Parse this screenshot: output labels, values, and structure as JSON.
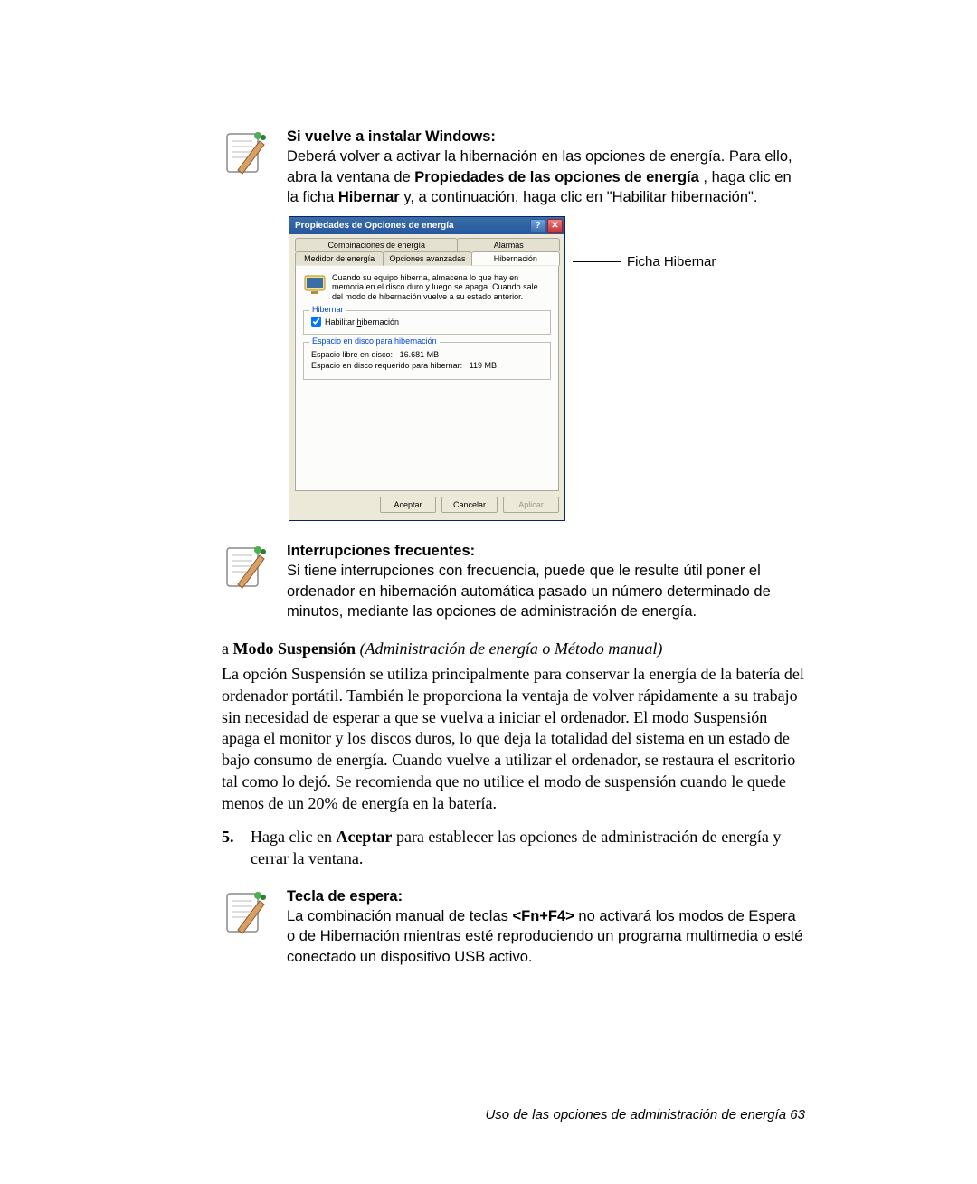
{
  "note1": {
    "heading": "Si vuelve a instalar Windows:",
    "l1a": "Deberá volver a activar la hibernación en las opciones de energía. Para ello, abra la ventana de ",
    "l1b": "Propiedades de las opciones de energía",
    "l1c": " , haga clic en la ficha ",
    "l1d": "Hibernar",
    "l1e": " y, a continuación, haga clic en \"Habilitar hibernación\"."
  },
  "dialog": {
    "title": "Propiedades de Opciones de energía",
    "tabs_row1": {
      "a": "Combinaciones de energía",
      "b": "Alarmas"
    },
    "tabs_row2": {
      "a": "Medidor de energía",
      "b": "Opciones avanzadas",
      "c": "Hibernación"
    },
    "info": "Cuando su equipo hiberna, almacena lo que hay en memoria en el disco duro y luego se apaga. Cuando sale del modo de hibernación vuelve a su estado anterior.",
    "fs1_legend": "Hibernar",
    "chk_label_pre": "Habilitar ",
    "chk_label_u": "h",
    "chk_label_post": "ibernación",
    "fs2_legend": "Espacio en disco para hibernación",
    "free_lbl": "Espacio libre en disco:",
    "free_val": "16.681 MB",
    "req_lbl": "Espacio en disco requerido para hibernar:",
    "req_val": "119 MB",
    "btn_ok": "Aceptar",
    "btn_cancel": "Cancelar",
    "btn_apply": "Aplicar"
  },
  "callout": "Ficha Hibernar",
  "note2": {
    "heading": "Interrupciones frecuentes:",
    "body": "Si tiene interrupciones con frecuencia, puede que le resulte útil poner el ordenador en hibernación automática pasado un número determinado de minutos, mediante las opciones de administración de energía."
  },
  "section": {
    "letter": "a ",
    "title": "Modo Suspensión",
    "paren": " (Administración de energía o Método manual)"
  },
  "para": "La opción Suspensión se utiliza principalmente para conservar la energía de la batería del ordenador portátil. También le proporciona la ventaja de volver rápidamente a su trabajo sin necesidad de esperar a que se vuelva a iniciar el ordenador. El modo Suspensión apaga el monitor y los discos duros, lo que deja la totalidad del sistema en un estado de bajo consumo de energía. Cuando vuelve a utilizar el ordenador, se restaura el escritorio tal como lo dejó. Se recomienda que no utilice el modo de suspensión cuando le quede menos de un 20% de energía en la batería.",
  "step": {
    "n": "5.",
    "a": "Haga clic en ",
    "b": "Aceptar",
    "c": " para establecer las opciones de administración de energía y cerrar la ventana."
  },
  "note3": {
    "heading": "Tecla de espera:",
    "a": "La combinación manual de teclas ",
    "b": "<Fn+F4>",
    "c": " no activará los modos de Espera o de Hibernación mientras esté reproduciendo un programa multimedia o esté conectado un dispositivo USB activo."
  },
  "footer": {
    "text": "Uso de las opciones de administración de energía",
    "page": "  63"
  }
}
